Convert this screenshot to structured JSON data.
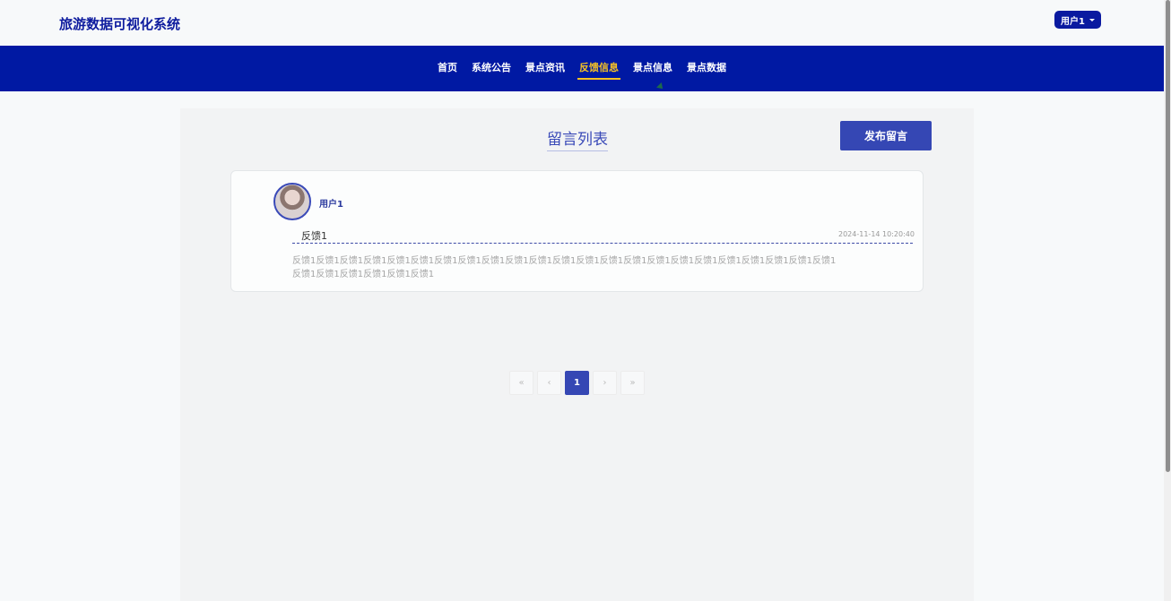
{
  "header": {
    "brand": "旅游数据可视化系统",
    "user_menu": "用户1"
  },
  "nav": {
    "items": [
      {
        "label": "首页",
        "active": false
      },
      {
        "label": "系统公告",
        "active": false
      },
      {
        "label": "景点资讯",
        "active": false
      },
      {
        "label": "反馈信息",
        "active": true
      },
      {
        "label": "景点信息",
        "active": false
      },
      {
        "label": "景点数据",
        "active": false
      }
    ],
    "active_color": "#f6c224",
    "bar_color": "#0019a3"
  },
  "main": {
    "title": "留言列表",
    "publish_button": "发布留言"
  },
  "posts": [
    {
      "username": "用户1",
      "title": "反馈1",
      "time": "2024-11-14 10:20:40",
      "body": "反馈1反馈1反馈1反馈1反馈1反馈1反馈1反馈1反馈1反馈1反馈1反馈1反馈1反馈1反馈1反馈1反馈1反馈1反馈1反馈1反馈1反馈1反馈1反馈1反馈1反馈1反馈1反馈1反馈1"
    }
  ],
  "pagination": {
    "first": "«",
    "prev": "‹",
    "current": "1",
    "next": "›",
    "last": "»"
  }
}
